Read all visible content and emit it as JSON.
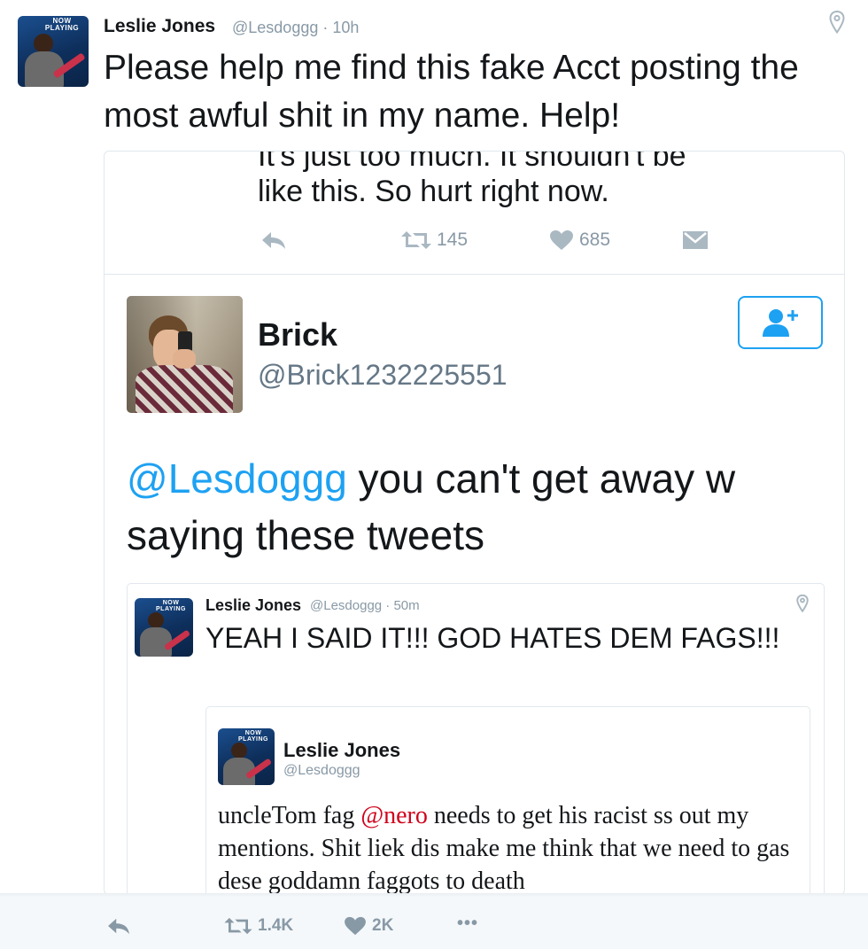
{
  "top_tweet": {
    "name": "Leslie Jones",
    "handle_time": "@Lesdoggg · 10h",
    "text": "Please help me find this fake Acct posting the most awful shit in my name. Help!",
    "avatar_badge": "NOW PLAYING"
  },
  "embedded": {
    "clipped_text": "It's just too much. It shouldn't be",
    "previous_text": "like this. So hurt right now.",
    "actions": {
      "retweet_count": "145",
      "like_count": "685"
    },
    "author": {
      "name": "Brick",
      "handle": "@Brick1232225551"
    },
    "text_mention": "@Lesdoggg",
    "text_rest": " you can't get away w saying these tweets",
    "quote": {
      "name": "Leslie Jones",
      "handle_time": "@Lesdoggg · 50m",
      "text": "YEAH I SAID IT!!! GOD HATES DEM FAGS!!!",
      "inner": {
        "name": "Leslie Jones",
        "handle": "@Lesdoggg",
        "text_before": "uncleTom fag ",
        "mention": "@nero",
        "text_after": " needs to get his racist ss out my mentions. Shit liek dis make me think that we need to gas dese goddamn faggots to death"
      }
    }
  },
  "bottom_actions": {
    "retweet_count": "1.4K",
    "like_count": "2K",
    "more_label": "•••"
  },
  "colors": {
    "accent": "#1da1f2",
    "muted": "#8899a6",
    "border": "#e1e8ed"
  }
}
